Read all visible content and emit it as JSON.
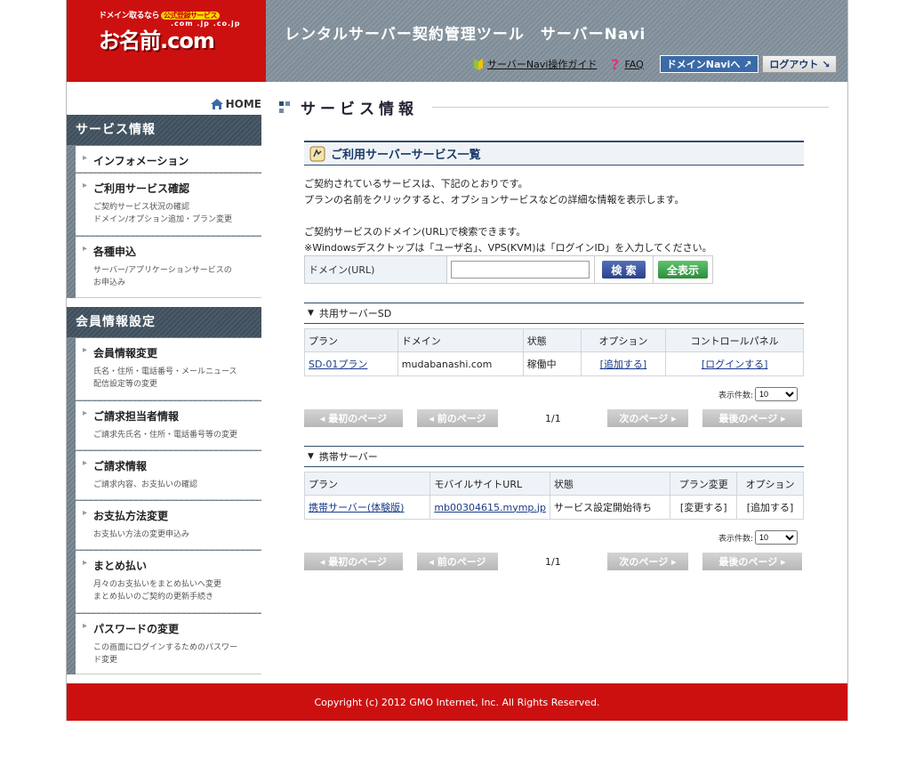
{
  "header": {
    "logo_tagline": "ドメイン取るなら",
    "logo_badge": "公式登録サービス",
    "logo_tld": ".com .jp .co.jp",
    "logo_text": "お名前.com",
    "app_title": "レンタルサーバー契約管理ツール　サーバーNavi",
    "guide_link": "サーバーNavi操作ガイド",
    "faq_link": "FAQ",
    "domain_navi_button": "ドメインNaviへ ↗",
    "logout_button": "ログアウト ↘"
  },
  "sidebar": {
    "home_label": "HOME",
    "service_section_title": "サービス情報",
    "service_items": [
      {
        "label": "インフォメーション",
        "desc": ""
      },
      {
        "label": "ご利用サービス確認",
        "desc": "ご契約サービス状況の確認\nドメイン/オプション追加・プラン変更"
      },
      {
        "label": "各種申込",
        "desc": "サーバー/アプリケーションサービスの\nお申込み"
      }
    ],
    "member_section_title": "会員情報設定",
    "member_items": [
      {
        "label": "会員情報変更",
        "desc": "氏名・住所・電話番号・メールニュース\n配信設定等の変更"
      },
      {
        "label": "ご請求担当者情報",
        "desc": "ご請求先氏名・住所・電話番号等の変更"
      },
      {
        "label": "ご請求情報",
        "desc": "ご請求内容、お支払いの確認"
      },
      {
        "label": "お支払方法変更",
        "desc": "お支払い方法の変更申込み"
      },
      {
        "label": "まとめ払い",
        "desc": "月々のお支払いをまとめ払いへ変更\nまとめ払いのご契約の更新手続き"
      },
      {
        "label": "パスワードの変更",
        "desc": "この画面にログインするためのパスワー\nド変更"
      }
    ]
  },
  "main": {
    "page_title": "サービス情報",
    "section_title": "ご利用サーバーサービス一覧",
    "intro_line1": "ご契約されているサービスは、下記のとおりです。",
    "intro_line2": "プランの名前をクリックすると、オプションサービスなどの詳細な情報を表示します。",
    "search_line1": "ご契約サービスのドメイン(URL)で検索できます。",
    "search_line2": "※Windowsデスクトップは「ユーザ名」、VPS(KVM)は「ログインID」を入力してください。",
    "search_label": "ドメイン(URL)",
    "search_value": "",
    "search_button": "検 索",
    "show_all_button": "全表示",
    "shared": {
      "title": "共用サーバーSD",
      "headers": [
        "プラン",
        "ドメイン",
        "状態",
        "オプション",
        "コントロールパネル"
      ],
      "row": {
        "plan": "SD-01プラン",
        "domain": "mudabanashi.com",
        "status": "稼働中",
        "option": "[追加する]",
        "panel": "[ログインする]"
      },
      "per_page_label": "表示件数:",
      "per_page_value": "10",
      "first_page": "◂ 最初のページ",
      "prev_page": "◂ 前のページ",
      "page_num": "1/1",
      "next_page": "次のページ ▸",
      "last_page": "最後のページ ▸"
    },
    "mobile": {
      "title": "携帯サーバー",
      "headers": [
        "プラン",
        "モバイルサイトURL",
        "状態",
        "プラン変更",
        "オプション"
      ],
      "row": {
        "plan": "携帯サーバー(体験版)",
        "url": "mb00304615.mymp.jp",
        "status": "サービス設定開始待ち",
        "change": "[変更する]",
        "option": "[追加する]"
      },
      "per_page_label": "表示件数:",
      "per_page_value": "10",
      "first_page": "◂ 最初のページ",
      "prev_page": "◂ 前のページ",
      "page_num": "1/1",
      "next_page": "次のページ ▸",
      "last_page": "最後のページ ▸"
    }
  },
  "footer": {
    "copyright": "Copyright (c) 2012 GMO Internet, Inc. All Rights Reserved."
  },
  "colors": {
    "brand_red": "#cc1010",
    "navy": "#2f4d6a",
    "header_gray": "#8b98a2"
  }
}
